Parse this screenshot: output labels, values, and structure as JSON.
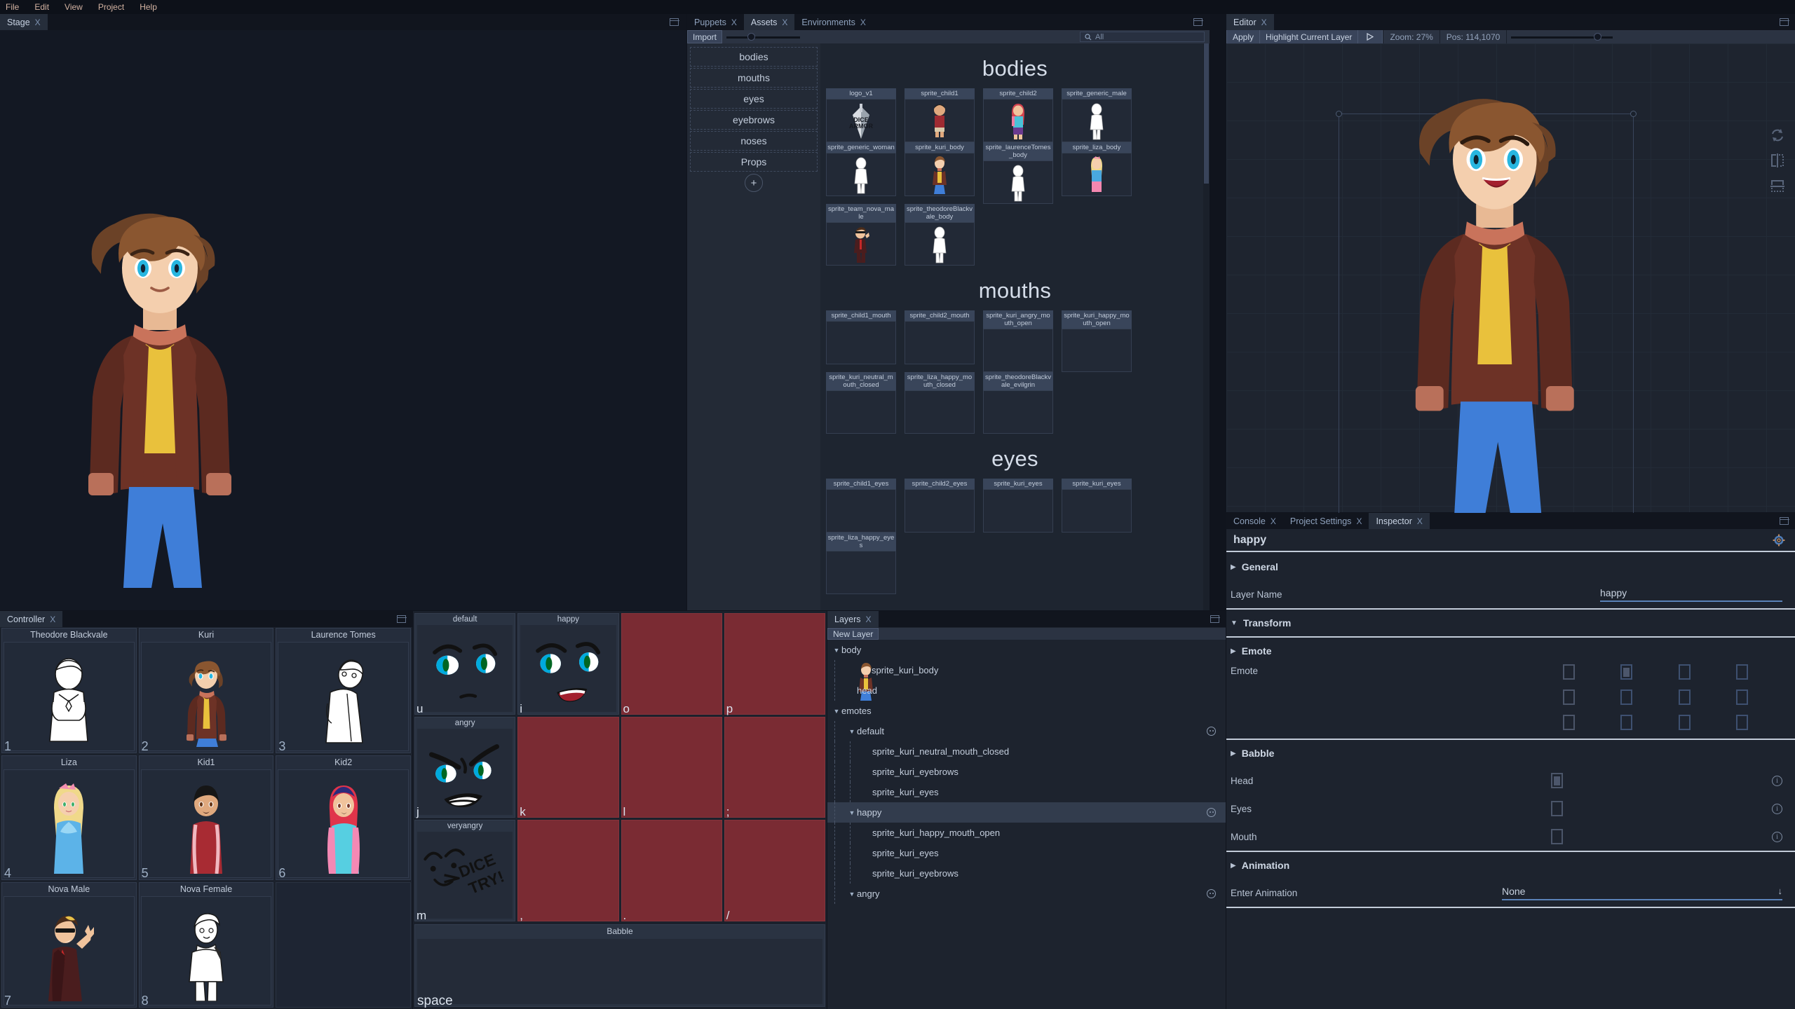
{
  "menubar": {
    "items": [
      "File",
      "Edit",
      "View",
      "Project",
      "Help"
    ]
  },
  "stage": {
    "tab": "Stage",
    "close": "X"
  },
  "assets": {
    "tabs": [
      {
        "label": "Puppets",
        "close": "X",
        "active": false
      },
      {
        "label": "Assets",
        "close": "X",
        "active": true
      },
      {
        "label": "Environments",
        "close": "X",
        "active": false
      }
    ],
    "import_label": "Import",
    "search_placeholder": "All",
    "search_value": "",
    "search_icon": "search-icon",
    "folders": [
      "bodies",
      "mouths",
      "eyes",
      "eyebrows",
      "noses",
      "Props"
    ],
    "add_folder_label": "+",
    "groups": [
      {
        "title": "bodies",
        "items": [
          {
            "name": "logo_v1",
            "kind": "logo"
          },
          {
            "name": "sprite_child1",
            "kind": "child1"
          },
          {
            "name": "sprite_child2",
            "kind": "child2"
          },
          {
            "name": "sprite_generic_male",
            "kind": "lineart"
          },
          {
            "name": "sprite_generic_woman",
            "kind": "lineart"
          },
          {
            "name": "sprite_kuri_body",
            "kind": "kuri"
          },
          {
            "name": "sprite_laurenceTomes_body",
            "kind": "lineart"
          },
          {
            "name": "sprite_liza_body",
            "kind": "liza"
          },
          {
            "name": "sprite_team_nova_male",
            "kind": "nova"
          },
          {
            "name": "sprite_theodoreBlackvale_body",
            "kind": "lineart"
          }
        ]
      },
      {
        "title": "mouths",
        "items": [
          {
            "name": "sprite_child1_mouth",
            "kind": "empty"
          },
          {
            "name": "sprite_child2_mouth",
            "kind": "empty"
          },
          {
            "name": "sprite_kuri_angry_mouth_open",
            "kind": "empty"
          },
          {
            "name": "sprite_kuri_happy_mouth_open",
            "kind": "empty"
          },
          {
            "name": "sprite_kuri_neutral_mouth_closed",
            "kind": "empty"
          },
          {
            "name": "sprite_liza_happy_mouth_closed",
            "kind": "empty"
          },
          {
            "name": "sprite_theodoreBlackvale_evilgrin",
            "kind": "empty"
          }
        ]
      },
      {
        "title": "eyes",
        "items": [
          {
            "name": "sprite_child1_eyes",
            "kind": "empty"
          },
          {
            "name": "sprite_child2_eyes",
            "kind": "empty"
          },
          {
            "name": "sprite_kuri_eyes",
            "kind": "empty"
          },
          {
            "name": "sprite_kuri_eyes",
            "kind": "empty"
          },
          {
            "name": "sprite_liza_happy_eyes",
            "kind": "empty"
          }
        ]
      }
    ]
  },
  "editor": {
    "tab": "Editor",
    "close": "X",
    "apply_label": "Apply",
    "highlight_label": "Highlight Current Layer",
    "play_icon": "play-icon",
    "zoom_label": "Zoom: 27%",
    "pos_label": "Pos: 114,1070",
    "tools": [
      "swap-icon",
      "mirror-horizontal-icon",
      "mirror-vertical-icon"
    ]
  },
  "inspector": {
    "tabs": [
      {
        "label": "Console",
        "close": "X",
        "active": false
      },
      {
        "label": "Project Settings",
        "close": "X",
        "active": false
      },
      {
        "label": "Inspector",
        "close": "X",
        "active": true
      }
    ],
    "title": "happy",
    "gear_icon": "gear-icon",
    "sections": {
      "general": {
        "label": "General",
        "expanded": false,
        "layer_name_label": "Layer Name",
        "layer_name_value": "happy"
      },
      "transform": {
        "label": "Transform",
        "expanded": true
      },
      "emote": {
        "label": "Emote",
        "expanded": false,
        "row_label": "Emote",
        "checked_index": 1,
        "rows": 3,
        "cols": 4
      },
      "babble": {
        "label": "Babble",
        "expanded": false,
        "rows": [
          {
            "label": "Head",
            "checked": true,
            "info": "info-icon"
          },
          {
            "label": "Eyes",
            "checked": false,
            "info": "info-icon"
          },
          {
            "label": "Mouth",
            "checked": false,
            "info": "info-icon"
          }
        ]
      },
      "animation": {
        "label": "Animation",
        "expanded": false,
        "enter_label": "Enter Animation",
        "enter_value": "None",
        "dropdown_icon": "arrow-down-icon"
      }
    }
  },
  "controller": {
    "tab": "Controller",
    "close": "X",
    "characters": [
      {
        "name": "Theodore Blackvale",
        "key": "1",
        "kind": "theodore"
      },
      {
        "name": "Kuri",
        "key": "2",
        "kind": "kuri"
      },
      {
        "name": "Laurence Tomes",
        "key": "3",
        "kind": "laurence"
      },
      {
        "name": "Liza",
        "key": "4",
        "kind": "liza"
      },
      {
        "name": "Kid1",
        "key": "5",
        "kind": "kid1"
      },
      {
        "name": "Kid2",
        "key": "6",
        "kind": "kid2"
      },
      {
        "name": "Nova Male",
        "key": "7",
        "kind": "novam"
      },
      {
        "name": "Nova Female",
        "key": "8",
        "kind": "novaf"
      },
      {
        "name": "",
        "key": "",
        "kind": "empty"
      }
    ]
  },
  "emotepad": {
    "cells": [
      {
        "label": "default",
        "key": "u",
        "empty": false,
        "face": "default"
      },
      {
        "label": "happy",
        "key": "i",
        "empty": false,
        "face": "happy"
      },
      {
        "label": "",
        "key": "o",
        "empty": true,
        "face": ""
      },
      {
        "label": "",
        "key": "p",
        "empty": true,
        "face": ""
      },
      {
        "label": "angry",
        "key": "j",
        "empty": false,
        "face": "angry"
      },
      {
        "label": "",
        "key": "k",
        "empty": true,
        "face": ""
      },
      {
        "label": "",
        "key": "l",
        "empty": true,
        "face": ""
      },
      {
        "label": "",
        "key": ";",
        "empty": true,
        "face": ""
      },
      {
        "label": "veryangry",
        "key": "m",
        "empty": false,
        "face": "veryangry"
      },
      {
        "label": "",
        "key": ",",
        "empty": true,
        "face": ""
      },
      {
        "label": "",
        "key": ".",
        "empty": true,
        "face": ""
      },
      {
        "label": "",
        "key": "/",
        "empty": true,
        "face": ""
      }
    ],
    "babble": {
      "label": "Babble",
      "key": "space"
    }
  },
  "layers": {
    "tab": "Layers",
    "close": "X",
    "new_layer_label": "New Layer",
    "tree": [
      {
        "label": "body",
        "depth": 0,
        "tri": "down",
        "emoji": false,
        "sel": false,
        "thumb": false
      },
      {
        "label": "sprite_kuri_body",
        "depth": 1,
        "tri": "",
        "emoji": false,
        "sel": false,
        "thumb": true
      },
      {
        "label": "head",
        "depth": 1,
        "tri": "",
        "emoji": false,
        "sel": false,
        "thumb": false
      },
      {
        "label": "emotes",
        "depth": 0,
        "tri": "down",
        "emoji": false,
        "sel": false,
        "thumb": false
      },
      {
        "label": "default",
        "depth": 1,
        "tri": "down",
        "emoji": true,
        "sel": false,
        "thumb": false
      },
      {
        "label": "sprite_kuri_neutral_mouth_closed",
        "depth": 2,
        "tri": "",
        "emoji": false,
        "sel": false,
        "thumb": false
      },
      {
        "label": "sprite_kuri_eyebrows",
        "depth": 2,
        "tri": "",
        "emoji": false,
        "sel": false,
        "thumb": false
      },
      {
        "label": "sprite_kuri_eyes",
        "depth": 2,
        "tri": "",
        "emoji": false,
        "sel": false,
        "thumb": false
      },
      {
        "label": "happy",
        "depth": 1,
        "tri": "down",
        "emoji": true,
        "sel": true,
        "thumb": false
      },
      {
        "label": "sprite_kuri_happy_mouth_open",
        "depth": 2,
        "tri": "",
        "emoji": false,
        "sel": false,
        "thumb": false
      },
      {
        "label": "sprite_kuri_eyes",
        "depth": 2,
        "tri": "",
        "emoji": false,
        "sel": false,
        "thumb": false
      },
      {
        "label": "sprite_kuri_eyebrows",
        "depth": 2,
        "tri": "",
        "emoji": false,
        "sel": false,
        "thumb": false
      },
      {
        "label": "angry",
        "depth": 1,
        "tri": "down",
        "emoji": true,
        "sel": false,
        "thumb": false
      }
    ]
  },
  "colors": {
    "bg": "#10141d",
    "panel": "#1d232e",
    "panel_alt": "#232a36",
    "toolbar": "#2b3342",
    "accent_blue": "#5a82b8",
    "empty_cell_red": "#7a2b33",
    "text": "#c8d0de",
    "text_dim": "#8fa2bd",
    "menu_text": "#d3b3a2"
  }
}
